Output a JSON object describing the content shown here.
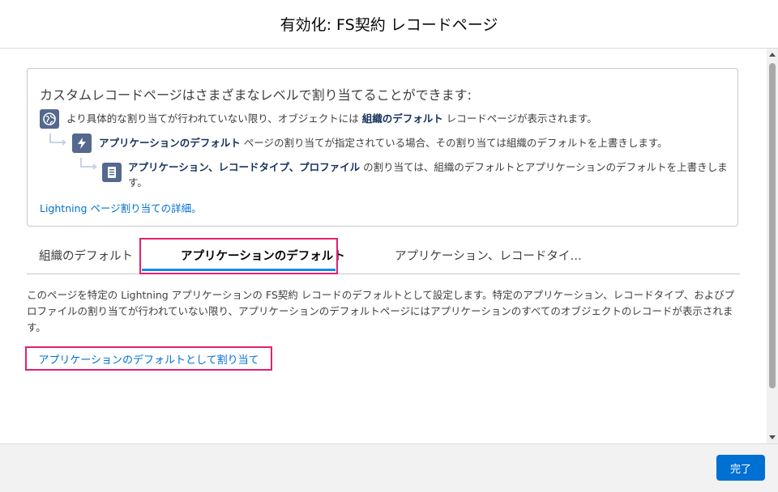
{
  "modal": {
    "title": "有効化: FS契約 レコードページ"
  },
  "info": {
    "title": "カスタムレコードページはさまざまなレベルで割り当てることができます:",
    "rows": [
      {
        "pre": "より具体的な割り当てが行われていない限り、オブジェクトには ",
        "bold": "組織のデフォルト",
        "post": " レコードページが表示されます。",
        "icon": "globe-icon"
      },
      {
        "pre": "",
        "bold": "アプリケーションのデフォルト",
        "post": " ページの割り当てが指定されている場合、その割り当ては組織のデフォルトを上書きします。",
        "icon": "lightning-icon"
      },
      {
        "pre": "",
        "bold": "アプリケーション、レコードタイプ、プロファイル",
        "post": " の割り当ては、組織のデフォルトとアプリケーションのデフォルトを上書きします。",
        "icon": "record-icon"
      }
    ],
    "link": "Lightning ページ割り当ての詳細。"
  },
  "tabs": [
    {
      "label": "組織のデフォルト",
      "active": false
    },
    {
      "label": "アプリケーションのデフォルト",
      "active": true
    },
    {
      "label": "アプリケーション、レコードタイ…",
      "active": false
    }
  ],
  "description": "このページを特定の Lightning アプリケーションの FS契約 レコードのデフォルトとして設定します。特定のアプリケーション、レコードタイプ、およびプロファイルの割り当てが行われていない限り、アプリケーションのデフォルトページにはアプリケーションのすべてのオブジェクトのレコードが表示されます。",
  "assign_button": "アプリケーションのデフォルトとして割り当て",
  "footer": {
    "done_label": "完了"
  },
  "colors": {
    "accent": "#0070d2",
    "highlight": "#e3206f",
    "icon_bg": "#54698d",
    "tab_active": "#1589ee"
  }
}
